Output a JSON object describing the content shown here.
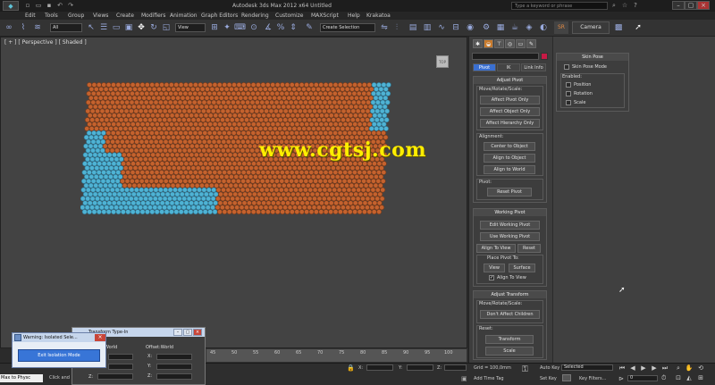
{
  "titlebar": {
    "title": "Autodesk 3ds Max  2012 x64      Untitled",
    "search_placeholder": "Type a keyword or phrase"
  },
  "menu": [
    "Edit",
    "Tools",
    "Group",
    "Views",
    "Create",
    "Modifiers",
    "Animation",
    "Graph Editors",
    "Rendering",
    "Customize",
    "MAXScript",
    "Help",
    "Krakatoa"
  ],
  "toolbar": {
    "filter_value": "All",
    "ref_coord_value": "View",
    "selection_set_placeholder": "Create Selection",
    "sr_label": "SR",
    "camera_label": "Camera"
  },
  "viewport": {
    "label": "[ + ] [ Perspective ] [ Shaded ]",
    "watermark": "www.cgtsj.com",
    "colors": {
      "orange": "#c4622e",
      "cyan": "#4fb3d4",
      "bg": "#434343"
    }
  },
  "hierarchy": {
    "tabs": [
      "Pivot",
      "IK",
      "Link Info"
    ],
    "adjust_pivot": {
      "title": "Adjust Pivot",
      "move_label": "Move/Rotate/Scale:",
      "buttons": [
        "Affect Pivot Only",
        "Affect Object Only",
        "Affect Hierarchy Only"
      ],
      "alignment_label": "Alignment:",
      "align_buttons": [
        "Center to Object",
        "Align to Object",
        "Align to World"
      ],
      "pivot_label": "Pivot:",
      "reset_pivot": "Reset Pivot"
    },
    "working_pivot": {
      "title": "Working Pivot",
      "edit": "Edit Working Pivot",
      "use": "Use Working Pivot",
      "align_to_view": "Align To View",
      "reset": "Reset",
      "place_label": "Place Pivot To:",
      "view": "View",
      "surface": "Surface",
      "align_check": "Align To View"
    },
    "adjust_transform": {
      "title": "Adjust Transform",
      "move_label": "Move/Rotate/Scale:",
      "dont_affect": "Don't Affect Children",
      "reset_label": "Reset:",
      "transform": "Transform",
      "scale": "Scale"
    }
  },
  "skin_pose": {
    "title": "Skin Pose",
    "mode": "Skin Pose Mode",
    "enabled_label": "Enabled:",
    "checks": [
      "Position",
      "Rotation",
      "Scale"
    ]
  },
  "timeline": {
    "ticks": [
      "45",
      "50",
      "55",
      "60",
      "65",
      "70",
      "75",
      "80",
      "85",
      "90",
      "95",
      "100"
    ]
  },
  "status": {
    "grid": "Grid = 100,0mm",
    "x_label": "X:",
    "y_label": "Y:",
    "z_label": "Z:",
    "auto_key": "Auto Key",
    "selected": "Selected",
    "set_key": "Set Key",
    "key_filters": "Key Filters...",
    "add_time_tag": "Add Time Tag",
    "frame": "0",
    "maxscript": "Max to Physc",
    "prompt": "Click and"
  },
  "warning_dialog": {
    "title": "Warning: Isolated Sele...",
    "button": "Exit Isolation Mode"
  },
  "tti_dialog": {
    "title": "Transform Type-In",
    "absolute_label": "World",
    "offset_label": "Offset:World",
    "x": "X:",
    "y": "Y:",
    "z": "Z:"
  }
}
